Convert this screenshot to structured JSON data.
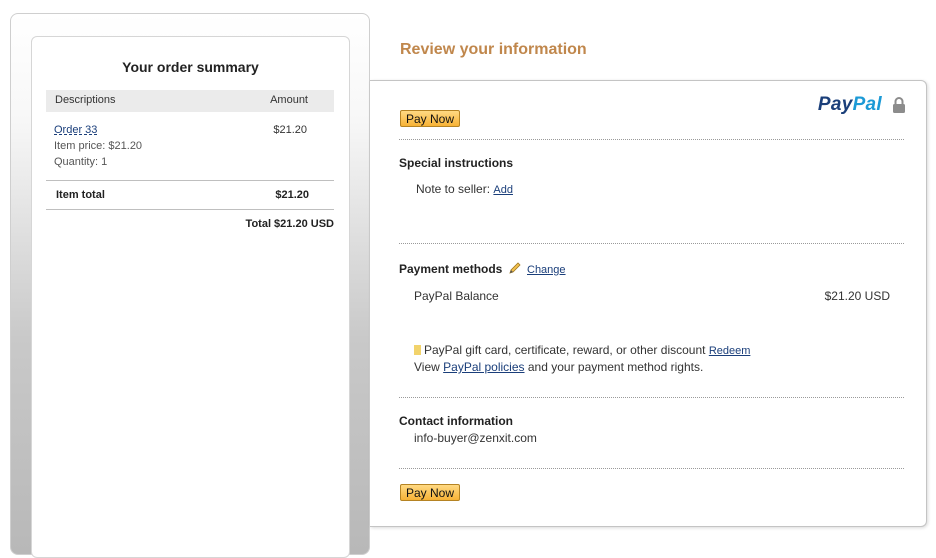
{
  "order_summary": {
    "title": "Your order summary",
    "columns": {
      "description": "Descriptions",
      "amount": "Amount"
    },
    "items": [
      {
        "name": "Order 33",
        "item_price": "Item price: $21.20",
        "quantity": "Quantity: 1",
        "amount": "$21.20"
      }
    ],
    "item_total_label": "Item total",
    "item_total_value": "$21.20",
    "grand_total": "Total $21.20 USD"
  },
  "review": {
    "heading": "Review your information",
    "logo": {
      "part1": "Pay",
      "part2": "Pal"
    },
    "pay_now_label": "Pay Now",
    "special_instructions": {
      "title": "Special instructions",
      "note_label": "Note to seller:",
      "add_link": "Add"
    },
    "payment_methods": {
      "title": "Payment methods",
      "change_link": "Change",
      "method_name": "PayPal Balance",
      "method_amount": "$21.20 USD",
      "gift_text": "PayPal gift card, certificate, reward, or other discount",
      "redeem_link": "Redeem",
      "policy_prefix": "View",
      "policy_link": "PayPal policies",
      "policy_suffix": "and your payment method rights."
    },
    "contact": {
      "title": "Contact information",
      "email": "info-buyer@zenxit.com"
    }
  },
  "colors": {
    "heading": "#c0874c",
    "paypal_dark_blue": "#1b3f7a",
    "paypal_light_blue": "#1c9ad6",
    "button": "#f7b236"
  },
  "icons": [
    "lock-icon",
    "pencil-icon",
    "gift-card-icon"
  ]
}
